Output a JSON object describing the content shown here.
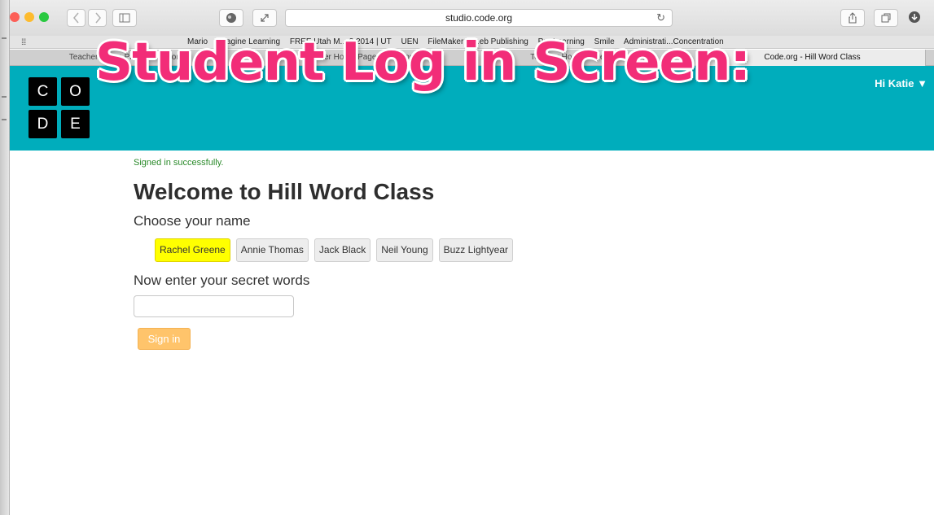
{
  "browser": {
    "url": "studio.code.org",
    "traffic_lights": [
      "#fc5f57",
      "#fdbb2e",
      "#29c940"
    ],
    "icons": {
      "back": "chevron-left-icon",
      "forward": "chevron-right-icon",
      "sidebar": "sidebar-icon",
      "privacy": "privacy-icon",
      "resize": "resize-icon",
      "reload": "reload-icon",
      "share": "share-icon",
      "tabs": "tabs-icon",
      "download": "download-icon"
    }
  },
  "bookmarks": {
    "items": [
      "Mario",
      "Imagine Learning",
      "FREE Utah M... 2 2014 | UT",
      "UEN",
      "FileMaker In...eb Publishing",
      "Pro Learning",
      "Smile",
      "Administrati...Concentration"
    ]
  },
  "tabs": [
    {
      "label": "Teacher Home Page | Code.org",
      "active": false
    },
    {
      "label": "Teacher Home Page | Code.org",
      "active": false
    },
    {
      "label": "Teacher Home Page | Code.org",
      "active": false
    },
    {
      "label": "Code.org - Hill Word Class",
      "active": true
    }
  ],
  "site": {
    "logo_letters": [
      "C",
      "O",
      "D",
      "E"
    ],
    "header_color": "#00adbc",
    "user_menu": "Hi Katie ▼",
    "overlay_title": "Student Log in Screen:",
    "overlay_color": "#f22d78"
  },
  "page": {
    "flash": "Signed in successfully.",
    "welcome": "Welcome to Hill Word Class",
    "choose_label": "Choose your name",
    "names": [
      {
        "label": "Rachel Greene",
        "selected": true
      },
      {
        "label": "Annie Thomas",
        "selected": false
      },
      {
        "label": "Jack Black",
        "selected": false
      },
      {
        "label": "Neil Young",
        "selected": false
      },
      {
        "label": "Buzz Lightyear",
        "selected": false
      }
    ],
    "secret_label": "Now enter your secret words",
    "secret_value": "",
    "sign_in_label": "Sign in",
    "selected_color": "#ffff00",
    "sign_in_color": "#ffc46b"
  }
}
